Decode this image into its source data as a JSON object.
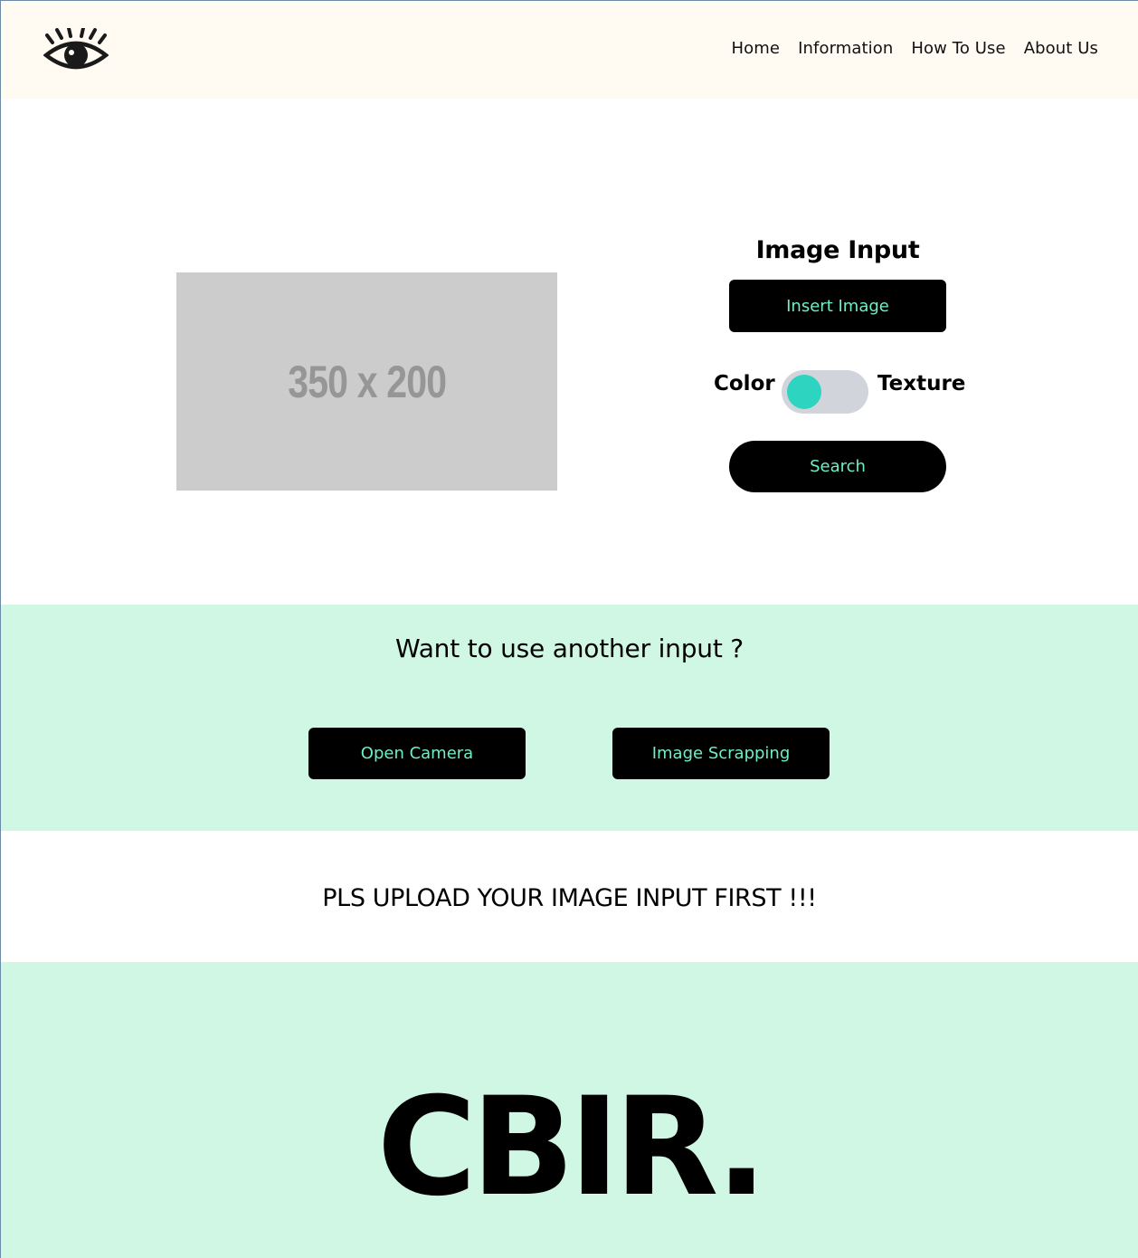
{
  "nav": {
    "logo_icon": "eye-icon",
    "links": [
      {
        "label": "Home"
      },
      {
        "label": "Information"
      },
      {
        "label": "How To Use"
      },
      {
        "label": "About Us"
      }
    ]
  },
  "hero": {
    "placeholder_text": "350 x 200",
    "input_title": "Image Input",
    "insert_button": "Insert Image",
    "toggle_left_label": "Color",
    "toggle_right_label": "Texture",
    "toggle_state": "Color",
    "search_button": "Search"
  },
  "alt_input": {
    "title": "Want to use another input ?",
    "camera_button": "Open Camera",
    "scrapping_button": "Image Scrapping"
  },
  "message": "PLS UPLOAD YOUR IMAGE INPUT FIRST !!!",
  "brand": "CBIR.",
  "colors": {
    "nav_bg": "#fffbf2",
    "section_bg": "#d0f7e4",
    "button_bg": "#000000",
    "button_text": "#6ef0c2",
    "toggle_knob": "#2dd4bf",
    "toggle_track": "#d1d5db"
  }
}
